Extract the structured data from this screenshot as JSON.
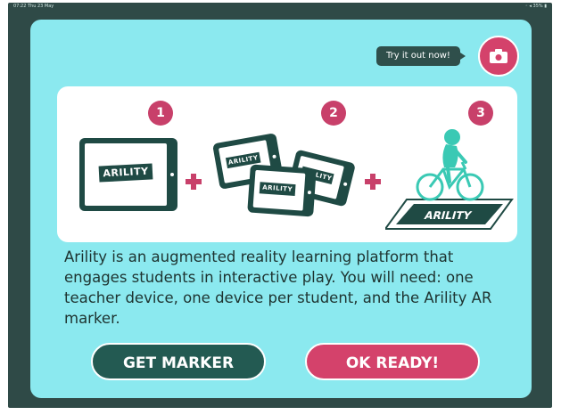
{
  "status": {
    "time": "07:22 Thu 23 May",
    "battery": "35%"
  },
  "header": {
    "try_label": "Try it out now!",
    "camera_icon": "camera-icon"
  },
  "steps": {
    "items": [
      {
        "number": "1"
      },
      {
        "number": "2"
      },
      {
        "number": "3"
      }
    ],
    "logo_text": "ARILITY"
  },
  "description": "Arility is an augmented reality learning platform that engages students in interactive play. You will need: one teacher device, one device per student, and the Arility AR marker.",
  "buttons": {
    "get_marker": "GET MARKER",
    "ok_ready": "OK READY!"
  },
  "colors": {
    "background": "#2f4a47",
    "card": "#8be9ef",
    "teal": "#235a52",
    "pink": "#d4426b",
    "bike": "#3ac9b4"
  }
}
